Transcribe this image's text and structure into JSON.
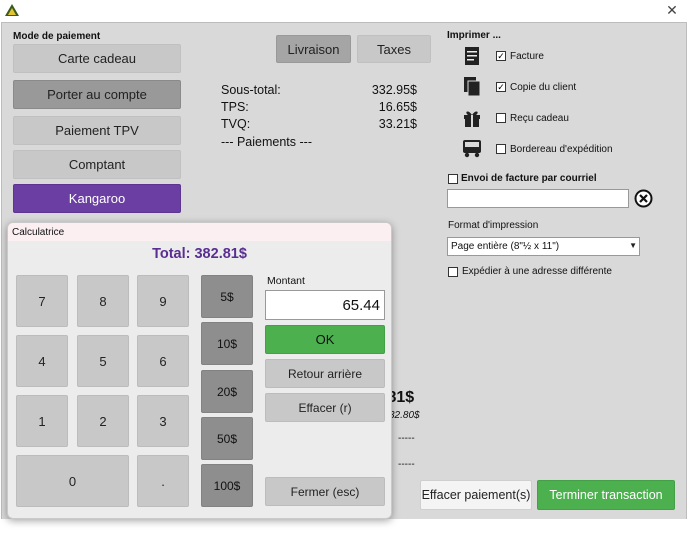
{
  "window": {
    "close_glyph": "✕",
    "icon": "app-logo-icon"
  },
  "payment_modes": {
    "label": "Mode de paiement",
    "items": [
      {
        "label": "Carte cadeau",
        "state": "normal"
      },
      {
        "label": "Porter au compte",
        "state": "dark"
      },
      {
        "label": "Paiement TPV",
        "state": "normal"
      },
      {
        "label": "Comptant",
        "state": "normal"
      },
      {
        "label": "Kangaroo",
        "state": "purple"
      }
    ]
  },
  "tabs": {
    "livraison": "Livraison",
    "taxes": "Taxes"
  },
  "summary": {
    "rows": [
      {
        "label": "Sous-total:",
        "value": "332.95$"
      },
      {
        "label": "TPS:",
        "value": "16.65$"
      },
      {
        "label": "TVQ:",
        "value": "33.21$"
      }
    ],
    "payments_label": "--- Paiements ---"
  },
  "print": {
    "label": "Imprimer ...",
    "options": [
      {
        "label": "Facture",
        "checked": true,
        "icon": "invoice-icon"
      },
      {
        "label": "Copie du client",
        "checked": true,
        "icon": "copy-icon"
      },
      {
        "label": "Reçu cadeau",
        "checked": false,
        "icon": "gift-icon"
      },
      {
        "label": "Bordereau d'expédition",
        "checked": false,
        "icon": "truck-icon"
      }
    ],
    "check_glyph": "✓"
  },
  "email": {
    "label": "Envoi de facture par courriel",
    "checked": false,
    "value": ""
  },
  "format": {
    "label": "Format d'impression",
    "selected": "Page entière (8\"½ x 11\")"
  },
  "ship_other": {
    "label": "Expédier à une adresse différente",
    "checked": false
  },
  "behind": {
    "total": ".81$",
    "italic": "32.80$",
    "dash1": "-----",
    "dash2": "-----"
  },
  "actions": {
    "clear_payments": "Effacer paiement(s)",
    "finish": "Terminer transaction"
  },
  "calculator": {
    "title": "Calculatrice",
    "total": "Total: 382.81$",
    "keys": [
      "7",
      "8",
      "9",
      "4",
      "5",
      "6",
      "1",
      "2",
      "3",
      "0",
      "."
    ],
    "money": [
      "5$",
      "10$",
      "20$",
      "50$",
      "100$"
    ],
    "amount_label": "Montant",
    "amount_value": "65.44",
    "ok": "OK",
    "backspace": "Retour arrière",
    "clear": "Effacer (r)",
    "close": "Fermer (esc)"
  },
  "colors": {
    "accent_purple": "#6a3ea3",
    "accent_green": "#4cb04f",
    "total_purple": "#5a2d91"
  }
}
